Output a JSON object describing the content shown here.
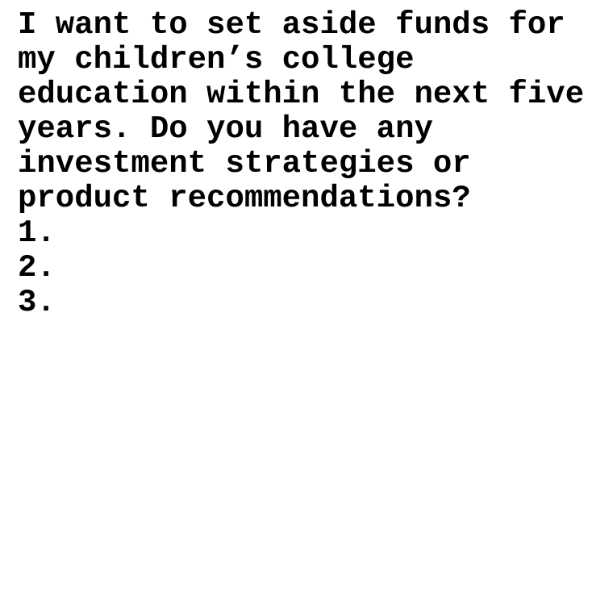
{
  "document": {
    "prompt_lines": [
      "I want to set aside funds for",
      "my children’s college",
      "education within the next five",
      "years. Do you have any",
      "investment strategies or",
      "product recommendations?"
    ],
    "list_items": [
      "1.",
      "2.",
      "3."
    ]
  }
}
